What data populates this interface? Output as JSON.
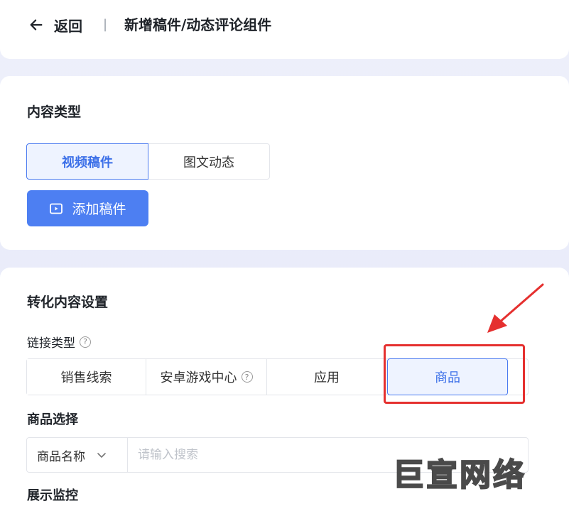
{
  "header": {
    "back_label": "返回",
    "separator": "|",
    "title": "新增稿件/动态评论组件"
  },
  "content_type": {
    "title": "内容类型",
    "tabs": [
      {
        "label": "视频稿件",
        "active": true
      },
      {
        "label": "图文动态",
        "active": false
      }
    ],
    "add_button": "添加稿件"
  },
  "conversion": {
    "title": "转化内容设置",
    "link_type_label": "链接类型",
    "link_types": [
      {
        "label": "销售线索",
        "active": false
      },
      {
        "label": "安卓游戏中心",
        "active": false,
        "help": true
      },
      {
        "label": "应用",
        "active": false
      },
      {
        "label": "商品",
        "active": true
      }
    ],
    "goods_label": "商品选择",
    "goods_select": "商品名称",
    "goods_placeholder": "请输入搜索",
    "monitor_label": "展示监控"
  },
  "watermark": "巨宣网络",
  "colors": {
    "accent": "#4d7ff2",
    "highlight": "#e5302f",
    "active_bg": "#eef3ff"
  }
}
